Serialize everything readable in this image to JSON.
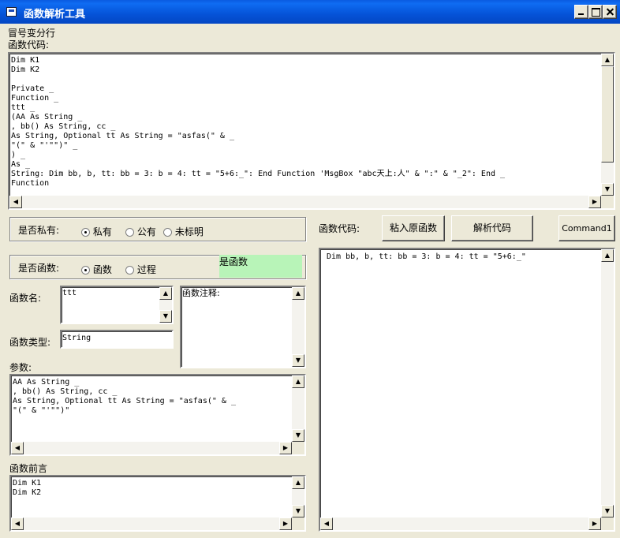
{
  "window": {
    "title": "函数解析工具"
  },
  "colon_split_label": "冒号变分行",
  "function_code_label": "函数代码:",
  "function_code_text": "Dim K1\nDim K2\n\nPrivate _\nFunction _\nttt _\n(AA As String _\n, bb() As String, cc _\nAs String, Optional tt As String = \"asfas(\" & _\n\"(\" & \"'\"\")\" _\n) _\nAs _\nString: Dim bb, b, tt: bb = 3: b = 4: tt = \"5+6:_\": End Function 'MsgBox \"abc天上:人\" & \":\" & \"_2\": End _\nFunction",
  "private_group": {
    "label": "是否私有:",
    "options": [
      "私有",
      "公有",
      "未标明"
    ],
    "selected": 0
  },
  "function_group": {
    "label": "是否函数:",
    "options": [
      "函数",
      "过程"
    ],
    "selected": 0
  },
  "status_label": "是函数",
  "status_color": "#b8f4b8",
  "fields": {
    "name_label": "函数名:",
    "name_value": "ttt",
    "comment_label": "函数注释:",
    "type_label": "函数类型:",
    "type_value": "String",
    "params_label": "参数:",
    "params_value": "AA As String _\n, bb() As String, cc _\nAs String, Optional tt As String = \"asfas(\" & _\n\"(\" & \"'\"\")\"",
    "preamble_label": "函数前言",
    "preamble_value": "Dim K1\nDim K2"
  },
  "right": {
    "code_label": "函数代码:",
    "paste_button": "粘入原函数",
    "parse_button": "解析代码",
    "command_button": "Command1",
    "output_value": "Dim bb, b, tt: bb = 3: b = 4: tt = \"5+6:_\""
  }
}
